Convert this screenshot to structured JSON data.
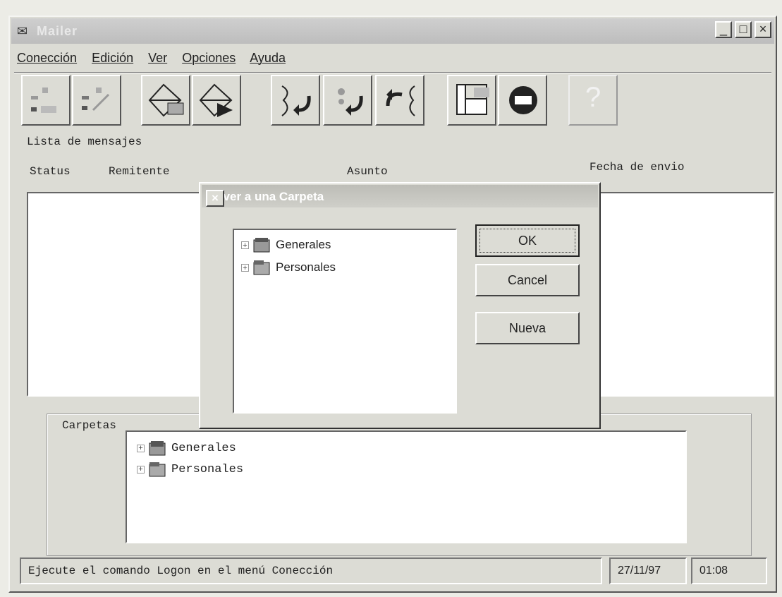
{
  "window": {
    "title": "Mailer",
    "min_label": "_",
    "max_label": "□",
    "close_label": "×"
  },
  "menu": [
    "Conección",
    "Edición",
    "Ver",
    "Opciones",
    "Ayuda"
  ],
  "toolbar": {
    "help_label": "?"
  },
  "message_list": {
    "section_label": "Lista de mensajes",
    "columns": {
      "status": "Status",
      "remitente": "Remitente",
      "asunto": "Asunto",
      "fecha": "Fecha de envio"
    }
  },
  "folders": {
    "section_label": "Carpetas",
    "items": [
      "Generales",
      "Personales"
    ],
    "expander": "+"
  },
  "status_bar": {
    "message": "Ejecute el comando Logon en el menú Conección",
    "date": "27/11/97",
    "time": "01:08"
  },
  "dialog": {
    "title": "Mover a una Carpeta",
    "close_label": "×",
    "items": [
      "Generales",
      "Personales"
    ],
    "ok": "OK",
    "cancel": "Cancel",
    "nueva": "Nueva"
  }
}
